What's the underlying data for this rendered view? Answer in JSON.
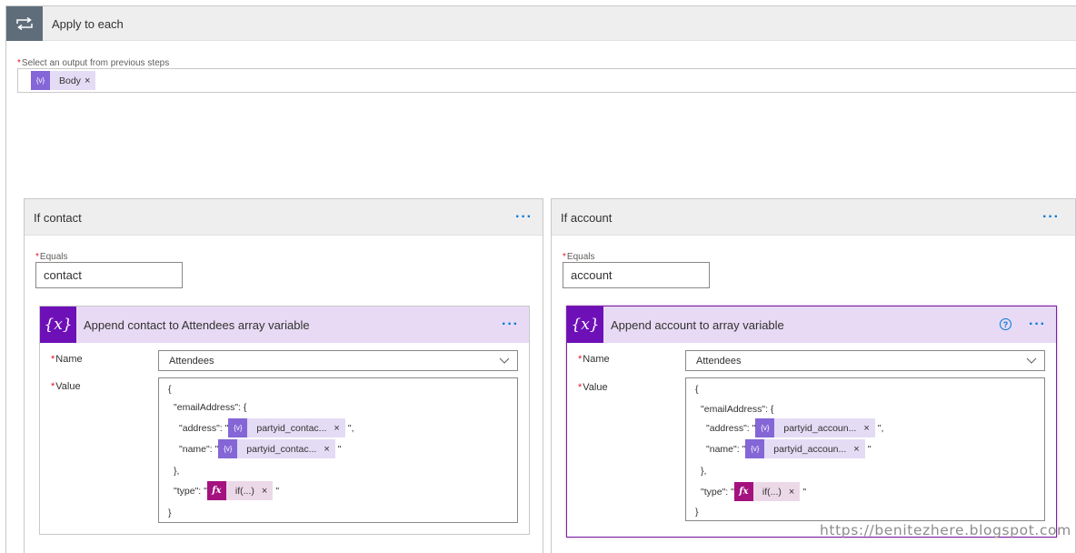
{
  "loop": {
    "title": "Apply to each",
    "select_label": "Select an output from previous steps",
    "selected_token": "Body"
  },
  "branches": [
    {
      "title": "If contact",
      "equals_label": "Equals",
      "equals_value": "contact",
      "action": {
        "title": "Append contact to Attendees array variable",
        "name_label": "Name",
        "name_value": "Attendees",
        "value_label": "Value",
        "lines": {
          "open_brace": "{",
          "email_key": "\"emailAddress\": {",
          "address_key": "\"address\": \"",
          "address_token": "partyid_contac...",
          "address_tail": "\",",
          "name_key": "\"name\": \"",
          "name_token": "partyid_contac...",
          "name_tail": "\"",
          "close_inner": "},",
          "type_key": "\"type\": \"",
          "type_token": "if(...)",
          "type_tail": "\"",
          "close_brace": "}"
        }
      }
    },
    {
      "title": "If account",
      "equals_label": "Equals",
      "equals_value": "account",
      "action": {
        "title": "Append account to array variable",
        "name_label": "Name",
        "name_value": "Attendees",
        "value_label": "Value",
        "lines": {
          "open_brace": "{",
          "email_key": "\"emailAddress\": {",
          "address_key": "\"address\": \"",
          "address_token": "partyid_accoun...",
          "address_tail": "\",",
          "name_key": "\"name\": \"",
          "name_token": "partyid_accoun...",
          "name_tail": "\"",
          "close_inner": "},",
          "type_key": "\"type\": \"",
          "type_token": "if(...)",
          "type_tail": "\"",
          "close_brace": "}"
        }
      }
    }
  ],
  "icons": {
    "var_token": "{v}",
    "fx_token": "fx",
    "var_action": "{x}",
    "remove": "×",
    "more": "···",
    "help": "?",
    "required": "*"
  },
  "watermark": "https://benitezhere.blogspot.com",
  "colors": {
    "loop_header_icon": "#5f6d7a",
    "variable_purple": "#6e10b8",
    "token_purple": "#8466d6",
    "fx_magenta": "#a4127f",
    "link_blue": "#0078d4",
    "required_red": "#e81123"
  }
}
